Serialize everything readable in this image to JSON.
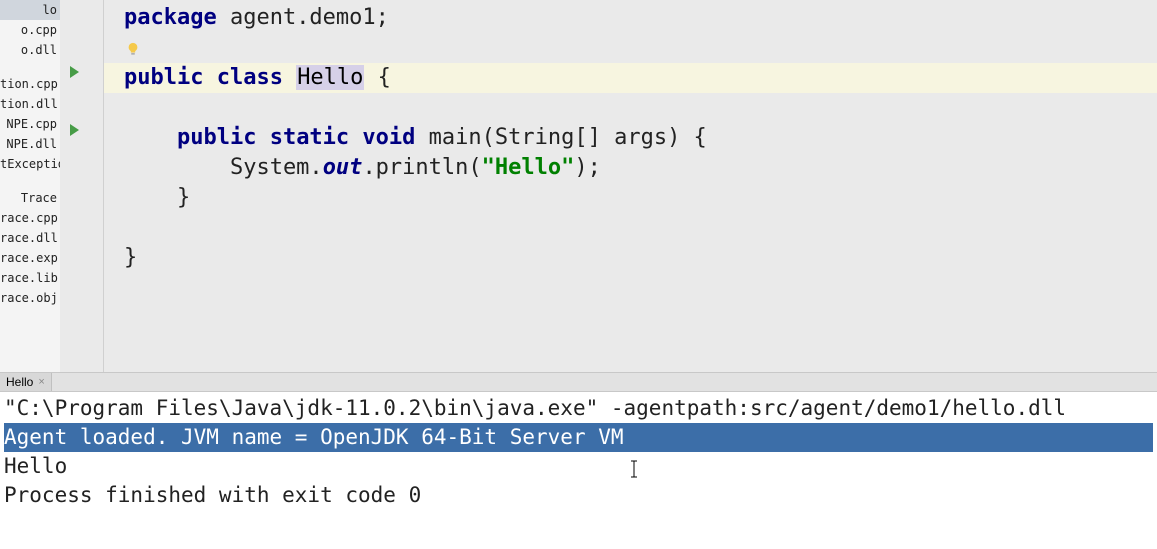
{
  "sidebar": {
    "items": [
      {
        "label": "lo",
        "selected": true
      },
      {
        "label": "o.cpp"
      },
      {
        "label": "o.dll"
      },
      {
        "spacer": true
      },
      {
        "label": "tion.cpp"
      },
      {
        "label": "tion.dll"
      },
      {
        "label": "NPE.cpp"
      },
      {
        "label": "NPE.dll"
      },
      {
        "label": "tException"
      },
      {
        "spacer": true
      },
      {
        "label": "Trace"
      },
      {
        "label": "race.cpp"
      },
      {
        "label": "race.dll"
      },
      {
        "label": "race.exp"
      },
      {
        "label": "race.lib"
      },
      {
        "label": "race.obj"
      }
    ]
  },
  "gutter": {
    "run_markers": [
      66,
      124
    ]
  },
  "code": {
    "lines": [
      {
        "tokens": [
          {
            "t": "package",
            "c": "kw"
          },
          {
            "t": " agent.demo1;",
            "c": "plain"
          }
        ]
      },
      {
        "tokens": []
      },
      {
        "highlight": true,
        "tokens": [
          {
            "t": "public class ",
            "c": "kw"
          },
          {
            "t": "Hello",
            "c": "sel-token"
          },
          {
            "t": " {",
            "c": "plain"
          }
        ]
      },
      {
        "tokens": []
      },
      {
        "tokens": [
          {
            "t": "    ",
            "c": "plain"
          },
          {
            "t": "public static void",
            "c": "kw"
          },
          {
            "t": " main(String[] args) {",
            "c": "plain"
          }
        ]
      },
      {
        "tokens": [
          {
            "t": "        System.",
            "c": "plain"
          },
          {
            "t": "out",
            "c": "kw-italic"
          },
          {
            "t": ".println(",
            "c": "plain"
          },
          {
            "t": "\"Hello\"",
            "c": "str"
          },
          {
            "t": ");",
            "c": "plain"
          }
        ]
      },
      {
        "tokens": [
          {
            "t": "    }",
            "c": "plain"
          }
        ]
      },
      {
        "tokens": []
      },
      {
        "tokens": [
          {
            "t": "}",
            "c": "plain"
          }
        ]
      }
    ]
  },
  "tab": {
    "label": "Hello",
    "close": "×"
  },
  "console": {
    "lines": [
      {
        "t": "\"C:\\Program Files\\Java\\jdk-11.0.2\\bin\\java.exe\" -agentpath:src/agent/demo1/hello.dll"
      },
      {
        "t": "Agent loaded. JVM name = OpenJDK 64-Bit Server VM",
        "hl": true
      },
      {
        "t": "Hello"
      },
      {
        "t": ""
      },
      {
        "t": "Process finished with exit code 0"
      }
    ]
  }
}
